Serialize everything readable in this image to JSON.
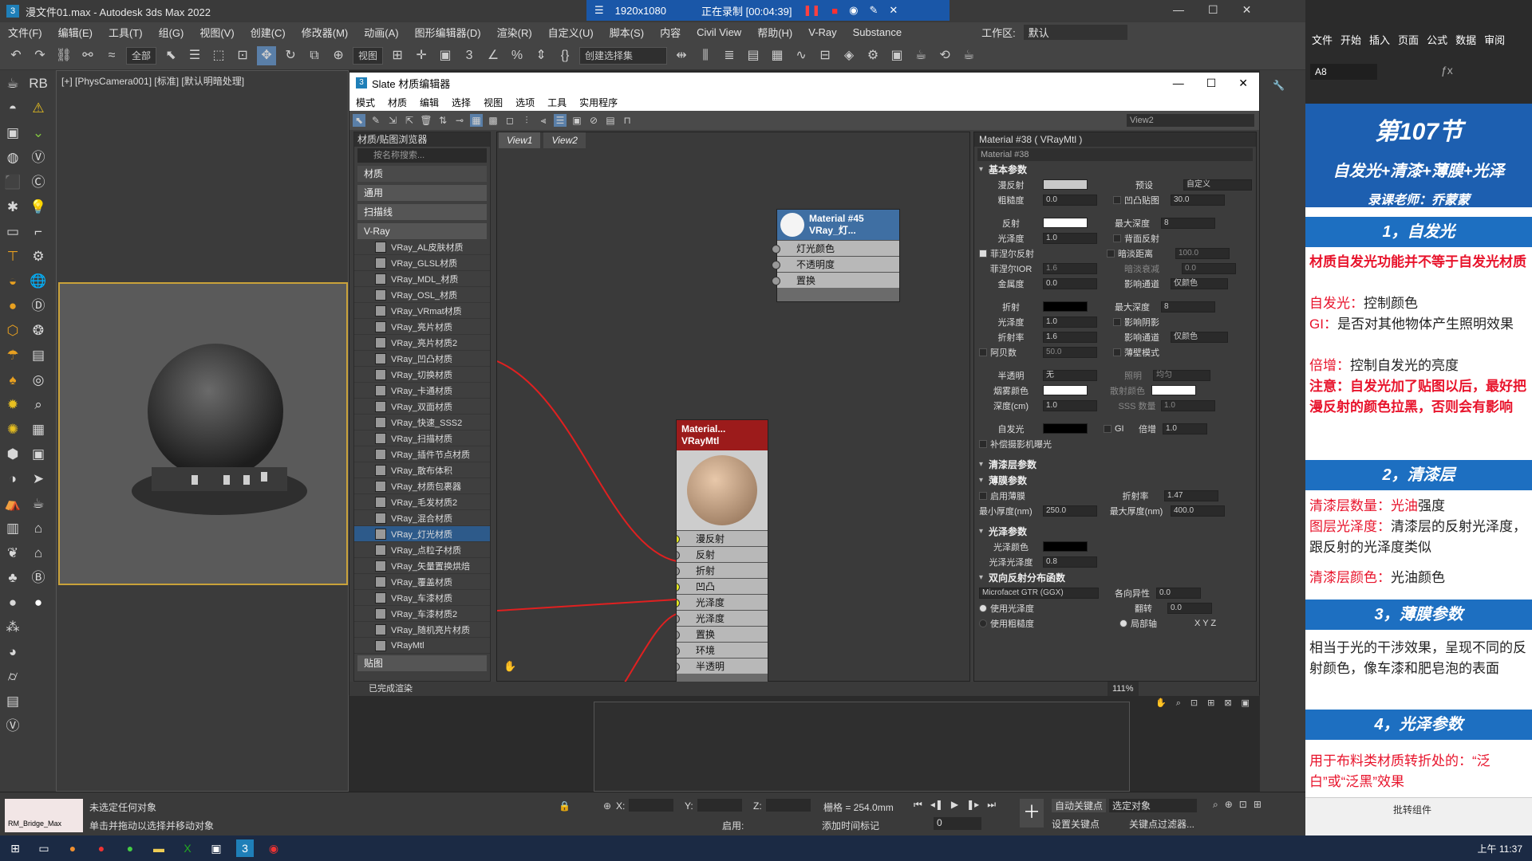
{
  "window": {
    "title": "漫文件01.max - Autodesk 3ds Max 2022"
  },
  "recorder": {
    "resolution": "1920x1080",
    "status": "正在录制 [00:04:39]"
  },
  "menu": [
    "文件(F)",
    "编辑(E)",
    "工具(T)",
    "组(G)",
    "视图(V)",
    "创建(C)",
    "修改器(M)",
    "动画(A)",
    "图形编辑器(D)",
    "渲染(R)",
    "自定义(U)",
    "脚本(S)",
    "内容",
    "Civil View",
    "帮助(H)",
    "V-Ray",
    "Substance"
  ],
  "workspace": {
    "label": "工作区:",
    "value": "默认"
  },
  "toolbar": {
    "filter": "全部",
    "view": "视图",
    "selset": "创建选择集"
  },
  "viewport": {
    "label": "[+] [PhysCamera001] [标准] [默认明暗处理]"
  },
  "sme": {
    "title": "Slate 材质编辑器",
    "menu": [
      "模式",
      "材质",
      "编辑",
      "选择",
      "视图",
      "选项",
      "工具",
      "实用程序"
    ],
    "browser": {
      "title": "材质/贴图浏览器",
      "search": "按名称搜索...",
      "group": "材质",
      "sub": [
        "通用",
        "扫描线",
        "V-Ray"
      ],
      "items": [
        "VRay_AL皮肤材质",
        "VRay_GLSL材质",
        "VRay_MDL_材质",
        "VRay_OSL_材质",
        "VRay_VRmat材质",
        "VRay_亮片材质",
        "VRay_亮片材质2",
        "VRay_凹凸材质",
        "VRay_切换材质",
        "VRay_卡通材质",
        "VRay_双面材质",
        "VRay_快速_SSS2",
        "VRay_扫描材质",
        "VRay_插件节点材质",
        "VRay_散布体积",
        "VRay_材质包裹器",
        "VRay_毛发材质2",
        "VRay_混合材质",
        "VRay_灯光材质",
        "VRay_点粒子材质",
        "VRay_矢量置换烘焙",
        "VRay_覆盖材质",
        "VRay_车漆材质",
        "VRay_车漆材质2",
        "VRay_随机亮片材质",
        "VRayMtl"
      ],
      "selected": "VRay_灯光材质",
      "more": "贴图"
    },
    "viewtabs": [
      "View1",
      "View2"
    ],
    "viewdd": "View2",
    "node1": {
      "title": "Material #45",
      "sub": "VRay_灯...",
      "slots": [
        "灯光颜色",
        "不透明度",
        "置换"
      ]
    },
    "node2": {
      "title": "Material...",
      "sub": "VRayMtl",
      "slots": [
        "漫反射",
        "反射",
        "折射",
        "凹凸",
        "光泽度",
        "光泽度",
        "置换",
        "环境",
        "半透明"
      ]
    },
    "zoom": "111%",
    "status": "已完成渲染",
    "props": {
      "header": "Material #38 ( VRayMtl )",
      "name": "Material #38",
      "sec_basic": "基本参数",
      "diffuse": "漫反射",
      "preset": "预设",
      "preset_val": "自定义",
      "rough": "粗糙度",
      "rough_val": "0.0",
      "bump": "凹凸贴图",
      "bump_val": "30.0",
      "reflect": "反射",
      "maxdepth": "最大深度",
      "maxdepth_val": "8",
      "gloss": "光泽度",
      "gloss_val": "1.0",
      "backrefl": "背面反射",
      "fresnel": "菲涅尔反射",
      "dimdist": "暗淡距离",
      "dimdist_val": "100.0",
      "fior": "菲涅尔IOR",
      "fior_val": "1.6",
      "dimfall": "暗淡衰减",
      "dimfall_val": "0.0",
      "metal": "金属度",
      "metal_val": "0.0",
      "affch": "影响通道",
      "affch_val": "仅颜色",
      "refract": "折射",
      "rmaxdepth_val": "8",
      "rgloss_val": "1.0",
      "affshadow": "影响阴影",
      "ior": "折射率",
      "ior_val": "1.6",
      "affch2_val": "仅颜色",
      "abbe": "阿贝数",
      "abbe_val": "50.0",
      "thin": "薄壁模式",
      "transl": "半透明",
      "transl_val": "无",
      "illum": "照明",
      "illum_val": "均匀",
      "fog": "烟雾颜色",
      "scatter": "散射颜色",
      "depth": "深度(cm)",
      "depth_val": "1.0",
      "sss": "SSS 数量",
      "sss_val": "1.0",
      "selfillum": "自发光",
      "gi": "GI",
      "mult": "倍增",
      "mult_val": "1.0",
      "compexp": "补偿摄影机曝光",
      "sec_coat": "清漆层参数",
      "sec_film": "薄膜参数",
      "film_on": "启用薄膜",
      "film_ior": "折射率",
      "film_ior_val": "1.47",
      "minth": "最小厚度(nm)",
      "minth_val": "250.0",
      "maxth": "最大厚度(nm)",
      "maxth_val": "400.0",
      "sec_sheen": "光泽参数",
      "sheen_col": "光泽颜色",
      "sheen_gl": "光泽光泽度",
      "sheen_gl_val": "0.8",
      "sec_brdf": "双向反射分布函数",
      "brdf": "Microfacet GTR (GGX)",
      "aniso": "各向异性",
      "aniso_val": "0.0",
      "usegloss": "使用光泽度",
      "rot": "翻转",
      "rot_val": "0.0",
      "userough": "使用粗糙度",
      "local": "局部轴",
      "axes": "X Y Z"
    }
  },
  "statusbar": {
    "sel": "未选定任何对象",
    "hint": "单击并拖动以选择并移动对象",
    "x": "X:",
    "y": "Y:",
    "z": "Z:",
    "grid": "栅格 = 254.0mm",
    "autokey": "自动关键点",
    "setkey": "设置关键点",
    "selobj": "选定对象",
    "keyfilter": "关键点过滤器...",
    "enable": "启用:",
    "addtime": "添加时间标记",
    "frame": "0",
    "script": "RM_Bridge_Max"
  },
  "ppt": {
    "menu": [
      "文件",
      "开始",
      "插入",
      "页面",
      "公式",
      "数据",
      "审阅"
    ],
    "cell": "A8",
    "title": "第107节",
    "subtitle": "自发光+清漆+薄膜+光泽",
    "teacher": "录课老师：乔蒙蒙",
    "h1": "1，自发光",
    "p1": "材质自发光功能并不等于自发光材质",
    "p2a": "自发光：",
    "p2b": "控制颜色",
    "p3a": "GI：",
    "p3b": "是否对其他物体产生照明效果",
    "p4a": "倍增：",
    "p4b": "控制自发光的亮度",
    "p5": "注意：自发光加了贴图以后，最好把漫反射的颜色拉黑，否则会有影响",
    "h2": "2，清漆层",
    "p6a": "清漆层数量：",
    "p6b": "光油",
    "p6c": "强度",
    "p7a": "图层光泽度：",
    "p7b": "清漆层的反射光泽度，跟反射的光泽度类似",
    "p8a": "清漆层颜色：",
    "p8b": "光油颜色",
    "h3": "3，薄膜参数",
    "p9": "相当于光的干涉效果，呈现不同的反射颜色，像车漆和肥皂泡的表面",
    "h4": "4，光泽参数",
    "p10": "用于布料类材质转折处的：“泛白”或“泛黑”效果",
    "bottom": "批转组件"
  },
  "clock": "上午 11:37"
}
